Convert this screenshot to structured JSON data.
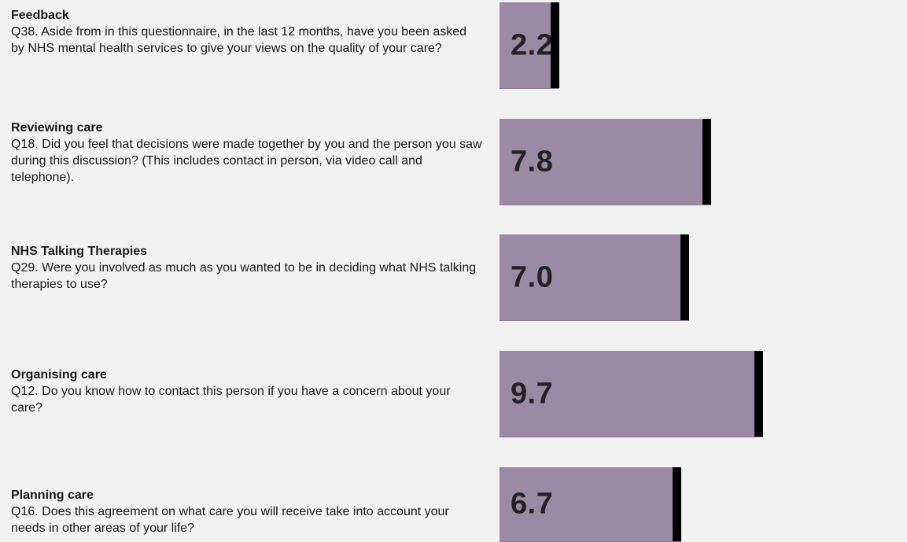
{
  "colors": {
    "background": "#f2f2f2",
    "bar_fill": "#9b8aa6",
    "marker": "#000000",
    "text": "#1a1a1a"
  },
  "chart_data": {
    "type": "bar",
    "orientation": "horizontal",
    "xlim": [
      0,
      10
    ],
    "grid": false,
    "legend": "none",
    "categories": [
      "Feedback",
      "Reviewing care",
      "NHS Talking Therapies",
      "Organising care",
      "Planning care"
    ],
    "values": [
      2.2,
      7.8,
      7.0,
      9.7,
      6.7
    ],
    "rows": [
      {
        "title": "Feedback",
        "question": "Q38. Aside from in this questionnaire, in the last 12 months, have you been asked by NHS mental health services to give your views on the quality of your care?",
        "value": 2.2,
        "value_label": "2.2"
      },
      {
        "title": "Reviewing care",
        "question": "Q18. Did you feel that decisions were made together by you and the person you saw during this discussion? (This includes contact in person, via video call and telephone).",
        "value": 7.8,
        "value_label": "7.8"
      },
      {
        "title": "NHS Talking Therapies",
        "question": "Q29. Were you involved as much as you wanted to be in deciding what NHS talking therapies to use?",
        "value": 7.0,
        "value_label": "7.0"
      },
      {
        "title": "Organising care",
        "question": "Q12. Do you know how to contact this person if you have a concern about your care?",
        "value": 9.7,
        "value_label": "9.7"
      },
      {
        "title": "Planning care",
        "question": "Q16. Does this agreement on what care you will receive take into account your needs in other areas of your life?",
        "value": 6.7,
        "value_label": "6.7"
      }
    ]
  }
}
